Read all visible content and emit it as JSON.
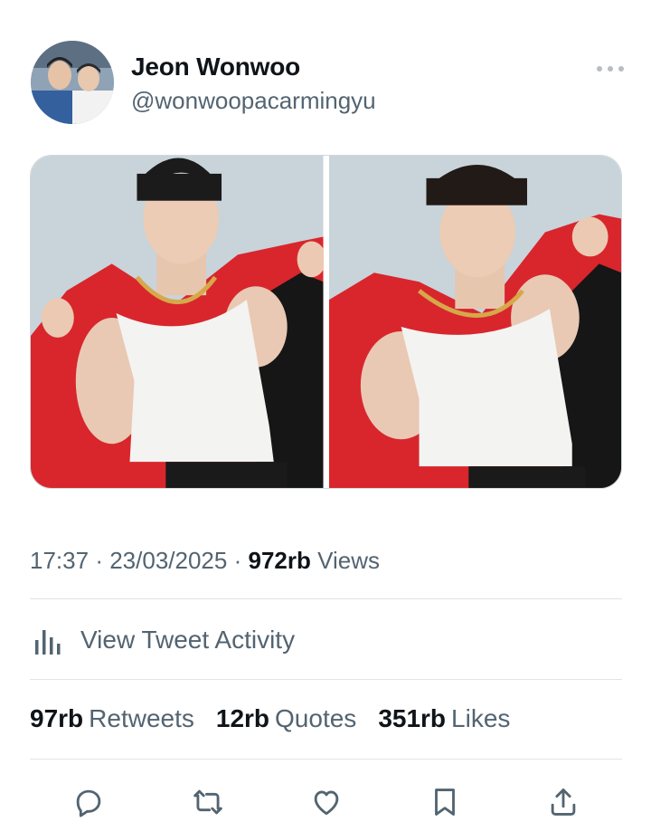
{
  "author": {
    "name": "Jeon Wonwoo",
    "handle": "@wonwoopacarmingyu"
  },
  "tweet": {
    "time": "17:37",
    "date": "23/03/2025",
    "views_count": "972rb",
    "views_label": "Views",
    "separator": "·"
  },
  "activity": {
    "label": "View Tweet Activity"
  },
  "stats": {
    "retweets_count": "97rb",
    "retweets_label": "Retweets",
    "quotes_count": "12rb",
    "quotes_label": "Quotes",
    "likes_count": "351rb",
    "likes_label": "Likes"
  },
  "colors": {
    "text_primary": "#0f1419",
    "text_secondary": "#536471",
    "divider": "#dfe4e8",
    "photo_background": "#c9d3da",
    "jacket_red": "#d8262c"
  },
  "icons": {
    "more": "more-dots-icon",
    "activity": "bar-chart-icon",
    "reply": "reply-icon",
    "retweet": "retweet-icon",
    "like": "heart-icon",
    "bookmark": "bookmark-icon",
    "share": "share-icon"
  }
}
